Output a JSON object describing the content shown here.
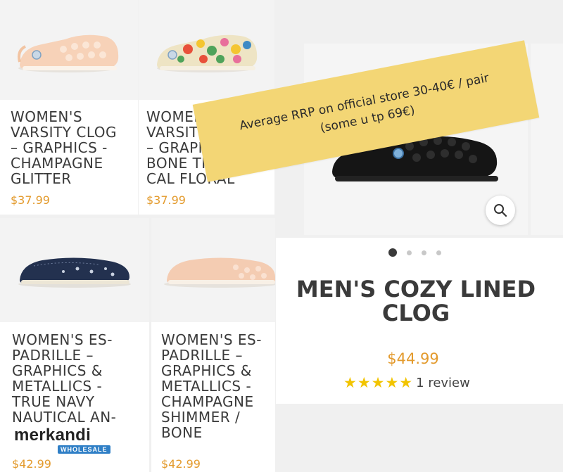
{
  "products": [
    {
      "title": "WOMEN'S\nVARSITY CLOG\n– GRAPHICS -\nCHAMPAGNE\nGLITTER",
      "price": "$37.99"
    },
    {
      "title": "WOMEN'S\nVARSITY CLOG\n– GRAPHICS -\nBONE TROPI-\nCAL FLORAL",
      "price": "$37.99"
    },
    {
      "title": "WOMEN'S ES-\nPADRILLE –\nGRAPHICS &\nMETALLICS -\nTRUE NAVY\nNAUTICAL AN-",
      "price": "$42.99"
    },
    {
      "title": "WOMEN'S ES-\nPADRILLE –\nGRAPHICS &\nMETALLICS -\nCHAMPAGNE\nSHIMMER /\nBONE",
      "price": "$42.99"
    }
  ],
  "banner": {
    "line1": "Average RRP on official store 30-40€ / pair",
    "line2": "(some u tp 69€)"
  },
  "featured": {
    "title": "MEN'S COZY LINED\nCLOG",
    "price": "$44.99",
    "stars": "★★★★★",
    "rating": 5,
    "review_count": "1 review",
    "carousel": {
      "slides": 4,
      "active": 1
    }
  },
  "watermark": {
    "name": "merkandi",
    "tag": "WHOLESALE"
  },
  "colors": {
    "price": "#e39a2c",
    "star": "#f2c400",
    "banner": "#f3d675",
    "title": "#3a3a3a"
  },
  "icons": [
    "search-icon"
  ]
}
